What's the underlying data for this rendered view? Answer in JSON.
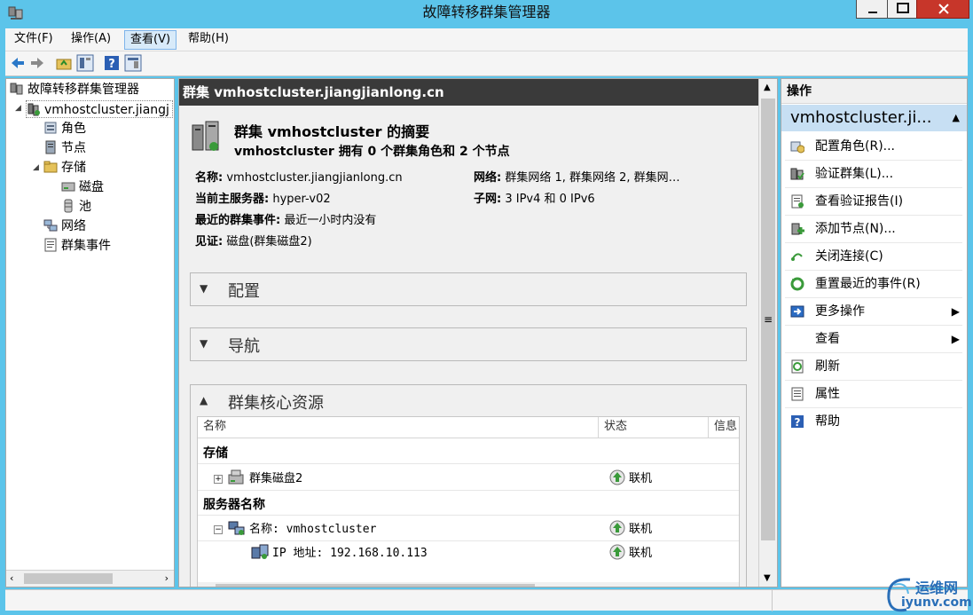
{
  "window": {
    "title": "故障转移群集管理器"
  },
  "menu": [
    "文件(F)",
    "操作(A)",
    "查看(V)",
    "帮助(H)"
  ],
  "tree": {
    "root": "故障转移群集管理器",
    "cluster": "vmhostcluster.jiangj",
    "roles": "角色",
    "nodes": "节点",
    "storage": "存储",
    "disks": "磁盘",
    "pools": "池",
    "networks": "网络",
    "events": "群集事件"
  },
  "center": {
    "header": "群集 vmhostcluster.jiangjianlong.cn",
    "summary_title": "群集 vmhostcluster 的摘要",
    "summary_subtitle": "vmhostcluster 拥有 0 个群集角色和 2 个节点",
    "name_label": "名称:",
    "name_value": "vmhostcluster.jiangjianlong.cn",
    "network_label": "网络:",
    "network_value": "群集网络 1, 群集网络 2, 群集网…",
    "host_label": "当前主服务器:",
    "host_value": "hyper-v02",
    "subnet_label": "子网:",
    "subnet_value": "3 IPv4 和 0 IPv6",
    "events_label": "最近的群集事件:",
    "events_value": "最近一小时内没有",
    "witness_label": "见证:",
    "witness_value": "磁盘(群集磁盘2)",
    "sections": {
      "config": "配置",
      "nav": "导航",
      "core": "群集核心资源"
    },
    "table": {
      "col_name": "名称",
      "col_status": "状态",
      "col_info": "信息",
      "group_storage": "存储",
      "disk_name": "群集磁盘2",
      "disk_status": "联机",
      "group_server": "服务器名称",
      "server_name": "名称: vmhostcluster",
      "server_status": "联机",
      "ip_name": "IP 地址: 192.168.10.113",
      "ip_status": "联机"
    }
  },
  "actions": {
    "header": "操作",
    "context": "vmhostcluster.ji...",
    "items": [
      {
        "label": "配置角色(R)...",
        "icon": "configure-role-icon"
      },
      {
        "label": "验证群集(L)...",
        "icon": "validate-cluster-icon"
      },
      {
        "label": "查看验证报告(I)",
        "icon": "view-report-icon"
      },
      {
        "label": "添加节点(N)...",
        "icon": "add-node-icon"
      },
      {
        "label": "关闭连接(C)",
        "icon": "close-connection-icon"
      },
      {
        "label": "重置最近的事件(R)",
        "icon": "reset-events-icon"
      },
      {
        "label": "更多操作",
        "icon": "more-actions-icon"
      },
      {
        "label": "查看",
        "icon": ""
      },
      {
        "label": "刷新",
        "icon": "refresh-icon"
      },
      {
        "label": "属性",
        "icon": "properties-icon"
      },
      {
        "label": "帮助",
        "icon": "help-icon"
      }
    ]
  },
  "watermark": {
    "line1": "运维网",
    "line2": "iyunv.com"
  },
  "colors": {
    "titlebar": "#5cc4ea",
    "header_dark": "#3a3a3a",
    "selection": "#c7dff3",
    "online_green": "#3a9a3a"
  }
}
